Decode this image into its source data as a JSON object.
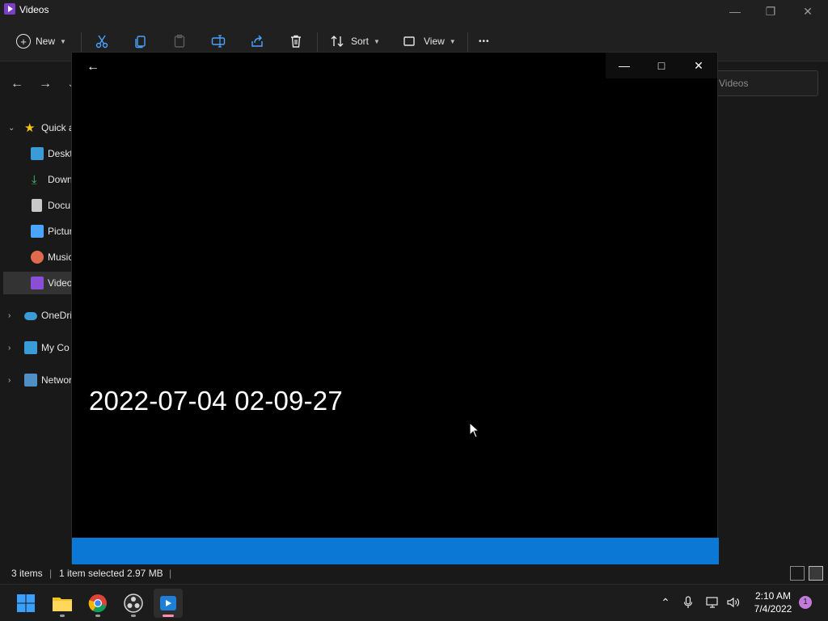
{
  "explorer": {
    "title": "Videos",
    "toolbar": {
      "new_label": "New",
      "sort_label": "Sort",
      "view_label": "View",
      "more_label": "•••"
    },
    "search_placeholder": "Videos",
    "sidebar": {
      "quick_access": "Quick a",
      "items": [
        "Deskt",
        "Down",
        "Docu",
        "Pictur",
        "Music",
        "Video"
      ],
      "onedrive": "OneDri",
      "my_computer": "My Co",
      "network": "Networ"
    },
    "status": {
      "items_count": "3 items",
      "selection": "1 item selected",
      "size": "2.97 MB"
    }
  },
  "player": {
    "video_title": "2022-07-04 02-09-27"
  },
  "taskbar": {
    "time": "2:10 AM",
    "date": "7/4/2022",
    "notification_count": "1"
  },
  "colors": {
    "accent": "#0a78d4",
    "background": "#191919",
    "player_background": "#000000"
  }
}
